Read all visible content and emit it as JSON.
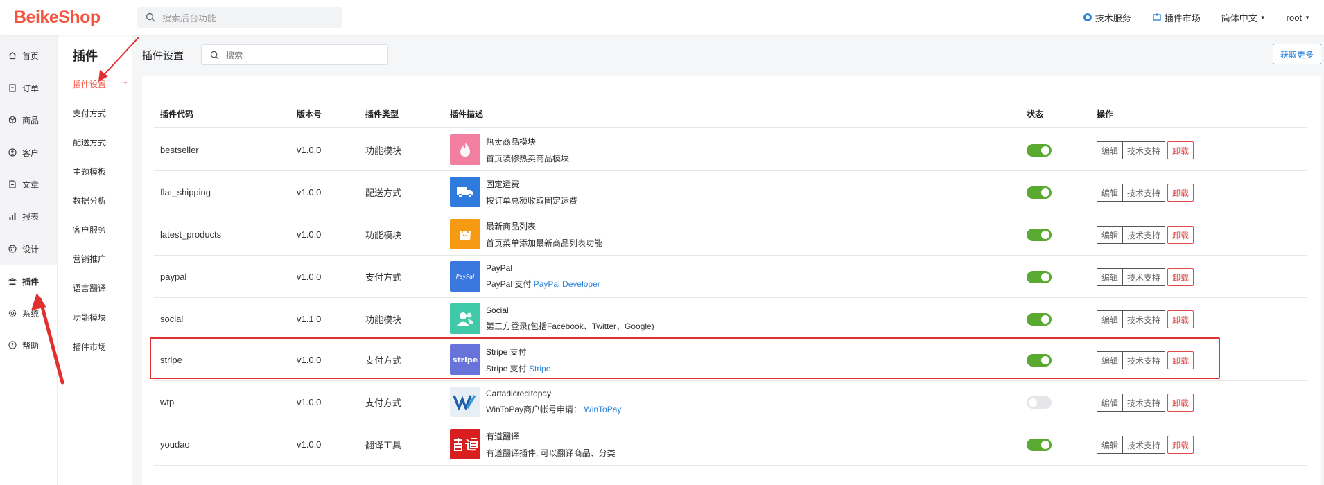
{
  "header": {
    "logo": "BeikeShop",
    "search_placeholder": "搜索后台功能",
    "tech_service": "技术服务",
    "plugin_market": "插件市场",
    "language": "简体中文",
    "user": "root"
  },
  "nav1": [
    {
      "label": "首页",
      "icon": "home-icon"
    },
    {
      "label": "订单",
      "icon": "order-icon"
    },
    {
      "label": "商品",
      "icon": "box-icon"
    },
    {
      "label": "客户",
      "icon": "user-icon"
    },
    {
      "label": "文章",
      "icon": "document-icon"
    },
    {
      "label": "报表",
      "icon": "chart-icon"
    },
    {
      "label": "设计",
      "icon": "palette-icon"
    },
    {
      "label": "插件",
      "icon": "plugin-icon"
    },
    {
      "label": "系统",
      "icon": "gear-icon"
    },
    {
      "label": "帮助",
      "icon": "help-icon"
    }
  ],
  "nav2": {
    "title": "插件",
    "items": [
      "插件设置",
      "支付方式",
      "配送方式",
      "主题模板",
      "数据分析",
      "客户服务",
      "营销推广",
      "语言翻译",
      "功能模块",
      "插件市场"
    ]
  },
  "page": {
    "title": "插件设置",
    "search_placeholder": "搜索",
    "get_more": "获取更多"
  },
  "table": {
    "headers": [
      "插件代码",
      "版本号",
      "插件类型",
      "插件描述",
      "状态",
      "操作"
    ],
    "buttons": {
      "edit": "编辑",
      "support": "技术支持",
      "uninstall": "卸载"
    },
    "rows": [
      {
        "code": "bestseller",
        "version": "v1.0.0",
        "type": "功能模块",
        "title": "热卖商品模块",
        "sub": "首页装修热卖商品模块",
        "link": "",
        "icon_color": "#f27ea0",
        "enabled": true
      },
      {
        "code": "flat_shipping",
        "version": "v1.0.0",
        "type": "配送方式",
        "title": "固定运费",
        "sub": "按订单总额收取固定运费",
        "link": "",
        "icon_color": "#2f7bdd",
        "enabled": true
      },
      {
        "code": "latest_products",
        "version": "v1.0.0",
        "type": "功能模块",
        "title": "最新商品列表",
        "sub": "首页菜单添加最新商品列表功能",
        "link": "",
        "icon_color": "#f59a12",
        "enabled": true
      },
      {
        "code": "paypal",
        "version": "v1.0.0",
        "type": "支付方式",
        "title": "PayPal",
        "sub": "PayPal 支付",
        "link": "PayPal Developer",
        "icon_color": "#3a78e0",
        "enabled": true
      },
      {
        "code": "social",
        "version": "v1.1.0",
        "type": "功能模块",
        "title": "Social",
        "sub": "第三方登录(包括Facebook、Twitter、Google)",
        "link": "",
        "icon_color": "#3fc9a8",
        "enabled": true
      },
      {
        "code": "stripe",
        "version": "v1.0.0",
        "type": "支付方式",
        "title": "Stripe 支付",
        "sub": "Stripe 支付",
        "link": "Stripe",
        "icon_color": "#6773d8",
        "enabled": true
      },
      {
        "code": "wtp",
        "version": "v1.0.0",
        "type": "支付方式",
        "title": "Cartadicreditopay",
        "sub": "WinToPay商户帐号申请：",
        "link": "WinToPay",
        "icon_color": "#e8eef5",
        "enabled": false
      },
      {
        "code": "youdao",
        "version": "v1.0.0",
        "type": "翻译工具",
        "title": "有道翻译",
        "sub": "有道翻译插件, 可以翻译商品、分类",
        "link": "",
        "icon_color": "#d81e1e",
        "enabled": true
      }
    ]
  }
}
